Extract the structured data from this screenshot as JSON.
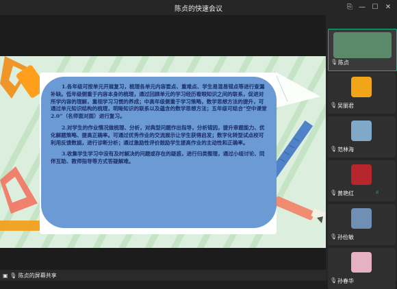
{
  "window": {
    "title": "陈贞的快速会议",
    "controls": [
      "⎘",
      "—",
      "☐",
      "✕"
    ]
  },
  "slide": {
    "paragraphs": [
      "1.各年级可按单元开展复习，梳理各单元内容要点、重难点、学生易混易错点等进行查漏补缺。低年级侧重于内容本身的梳理，通过回顾单元的学习经历看眼知识之间的联系，促进对所学内容的理解，重视学习习惯的养成；中高年级侧重于学习策略，数学思想方法的提升，可通过单元知识结构的梳理，明晰知识的联系以及蕴含的数学思想方法；五年级可结合“空中课堂2.0”（名师面对面）进行复习。",
      "2.对学生的作业情况做梳理、分析，对典型问题作出指导，分析错因，提升审题能力、优化解题策略、提高正确率。可通过优秀作业的交流展示让学生获得启发；数字化转型试点校可利用反馈数据，进行诊断分析；通过激励性评价鼓励学生提高作业的主动性和正确率。",
      "3.收集学生学习中没有及时解决的问题或存在的疑惑，进行归类整理，通过小组讨论、同伴互助、教师指导等方式答疑解难。"
    ]
  },
  "participants": [
    {
      "name": "陈贞",
      "icon": "mic-icon",
      "color": "#5a8a6a",
      "active": true
    },
    {
      "name": "吴丽君",
      "icon": "mic-muted-icon",
      "color": "#f2a516"
    },
    {
      "name": "范林海",
      "icon": "mic-muted-icon",
      "color": "#7fa8c9"
    },
    {
      "name": "黄艳红",
      "icon": "mic-muted-icon",
      "color": "#b8262d",
      "signal": "ıl"
    },
    {
      "name": "孙俭敏",
      "icon": "mic-muted-icon",
      "color": "#6f8fb5"
    },
    {
      "name": "孙春华",
      "icon": "mic-muted-icon",
      "color": "#e7b1c4"
    }
  ],
  "bottom": {
    "share_label": "陈贞的屏幕共享"
  }
}
